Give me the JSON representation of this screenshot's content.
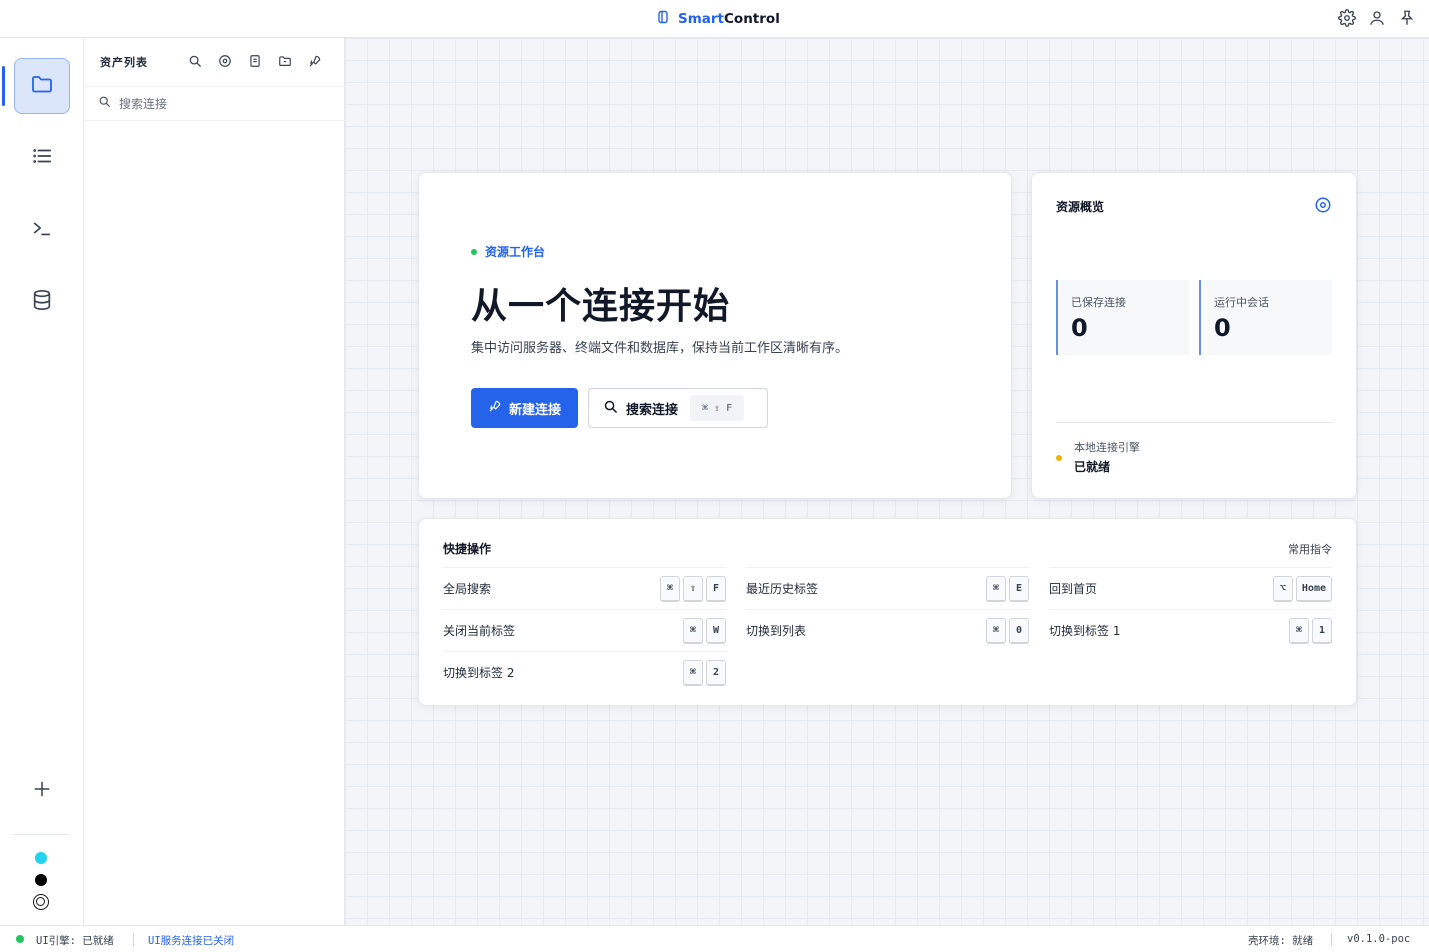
{
  "topbar": {
    "brand_part1": "Smart",
    "brand_part2": "Control",
    "icons": [
      "settings-gear-icon",
      "user-icon",
      "pin-icon"
    ]
  },
  "rail": {
    "items": [
      {
        "name": "folder-icon",
        "active": true
      },
      {
        "name": "list-icon",
        "active": false
      },
      {
        "name": "terminal-icon",
        "active": false
      },
      {
        "name": "database-icon",
        "active": false
      }
    ],
    "add_icon": "plus-icon",
    "status_dots": [
      "#22d3ee",
      "#000000",
      "#ffffff"
    ]
  },
  "panel": {
    "title": "资产列表",
    "tools": [
      "search-icon",
      "target-icon",
      "file-icon",
      "folder-add-icon",
      "rocket-icon"
    ],
    "search_placeholder": "搜索连接"
  },
  "hero": {
    "tag": "资源工作台",
    "title": "从一个连接开始",
    "subtitle": "集中访问服务器、终端文件和数据库，保持当前工作区清晰有序。",
    "primary_button": "新建连接",
    "secondary_button": "搜索连接",
    "secondary_shortcut": "⌘ ⇧ F"
  },
  "overview": {
    "title": "资源概览",
    "stats": [
      {
        "label": "已保存连接",
        "value": "0"
      },
      {
        "label": "运行中会话",
        "value": "0"
      }
    ],
    "engine_label": "本地连接引擎",
    "engine_status": "已就绪"
  },
  "quick": {
    "title": "快捷操作",
    "link": "常用指令",
    "rows": [
      {
        "label": "全局搜索",
        "keys": [
          "⌘",
          "⇧",
          "F"
        ]
      },
      {
        "label": "最近历史标签",
        "keys": [
          "⌘",
          "E"
        ]
      },
      {
        "label": "回到首页",
        "keys": [
          "⌥",
          "Home"
        ]
      },
      {
        "label": "关闭当前标签",
        "keys": [
          "⌘",
          "W"
        ]
      },
      {
        "label": "切换到列表",
        "keys": [
          "⌘",
          "0"
        ]
      },
      {
        "label": "切换到标签  1",
        "keys": [
          "⌘",
          "1"
        ]
      },
      {
        "label": "切换到标签  2",
        "keys": [
          "⌘",
          "2"
        ]
      }
    ]
  },
  "statusbar": {
    "engine": "UI引擎: 已就绪",
    "service": "UI服务连接已关闭",
    "shell": "壳环境: 就绪",
    "version": "v0.1.0-poc"
  },
  "colors": {
    "accent": "#2563eb",
    "ready": "#22c55e",
    "warning": "#eab308"
  }
}
